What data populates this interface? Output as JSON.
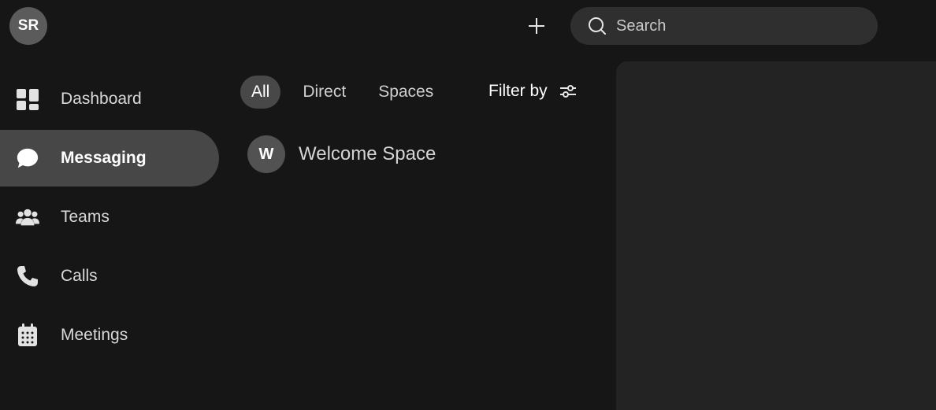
{
  "user": {
    "initials": "SR"
  },
  "topbar": {
    "add_icon": "plus-icon",
    "search_placeholder": "Search",
    "search_icon": "search-icon"
  },
  "sidebar": {
    "items": [
      {
        "label": "Dashboard",
        "icon": "dashboard-icon",
        "active": false
      },
      {
        "label": "Messaging",
        "icon": "chat-bubble-icon",
        "active": true
      },
      {
        "label": "Teams",
        "icon": "people-icon",
        "active": false
      },
      {
        "label": "Calls",
        "icon": "phone-icon",
        "active": false
      },
      {
        "label": "Meetings",
        "icon": "calendar-icon",
        "active": false
      }
    ]
  },
  "filters": {
    "tabs": [
      {
        "label": "All",
        "selected": true
      },
      {
        "label": "Direct",
        "selected": false
      },
      {
        "label": "Spaces",
        "selected": false
      }
    ],
    "filter_by_label": "Filter by",
    "filter_icon": "sliders-icon"
  },
  "spaces": [
    {
      "initial": "W",
      "name": "Welcome Space"
    }
  ],
  "colors": {
    "background": "#161616",
    "active_item": "#474747",
    "search_bg": "#2f2f2f",
    "panel_bg": "#232323"
  }
}
